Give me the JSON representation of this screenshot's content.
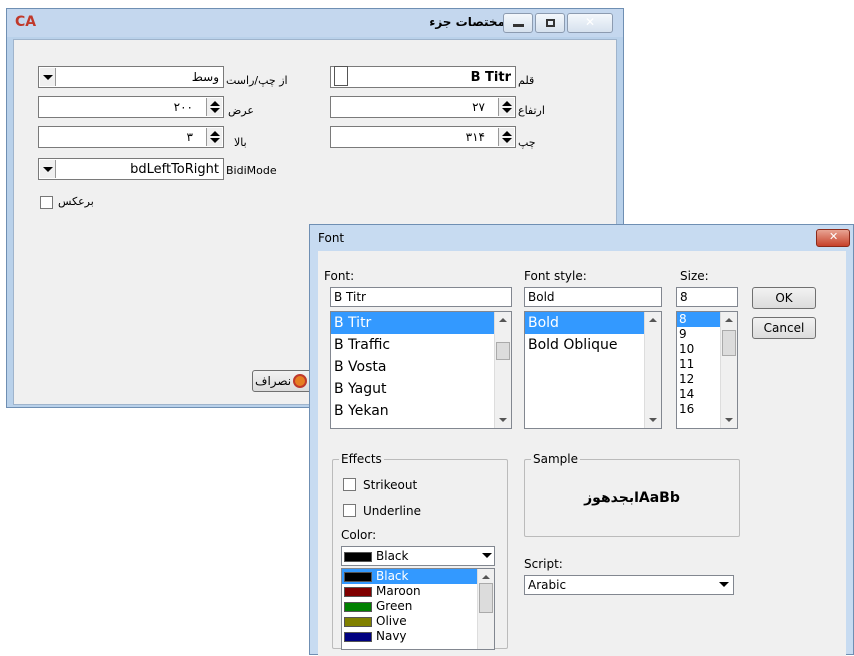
{
  "props_window": {
    "title": "مختصات جزء",
    "logo": "CA",
    "fields": {
      "font_label": "قلم",
      "font_value": "B Titr",
      "align_label": "از چپ/راست",
      "align_value": "وسط",
      "height_label": "ارتفاع",
      "height_value": "۲۷",
      "width_label": "عرض",
      "width_value": "۲۰۰",
      "left_label": "چپ",
      "left_value": "۳۱۴",
      "top_label": "بالا",
      "top_value": "۳",
      "bidi_label": "BidiMode",
      "bidi_value": "bdLeftToRight",
      "reverse_label": "برعکس"
    },
    "cancel_label": "نصراف"
  },
  "font_dialog": {
    "title": "Font",
    "font_label": "Font:",
    "font_value": "B Titr",
    "style_label": "Font style:",
    "style_value": "Bold",
    "size_label": "Size:",
    "size_value": "8",
    "fonts": [
      "B Titr",
      "B Traffic",
      "B Vosta",
      "B Yagut",
      "B Yekan"
    ],
    "styles": [
      "Bold",
      "Bold Oblique"
    ],
    "sizes": [
      "8",
      "9",
      "10",
      "11",
      "12",
      "14",
      "16"
    ],
    "ok": "OK",
    "cancel": "Cancel",
    "effects_label": "Effects",
    "strikeout": "Strikeout",
    "underline": "Underline",
    "color_label": "Color:",
    "color_value": "Black",
    "colors": [
      {
        "name": "Black",
        "hex": "#000000"
      },
      {
        "name": "Maroon",
        "hex": "#800000"
      },
      {
        "name": "Green",
        "hex": "#008000"
      },
      {
        "name": "Olive",
        "hex": "#808000"
      },
      {
        "name": "Navy",
        "hex": "#000080"
      }
    ],
    "sample_label": "Sample",
    "sample_text": "ابجدهوزAaBb",
    "script_label": "Script:",
    "script_value": "Arabic"
  }
}
